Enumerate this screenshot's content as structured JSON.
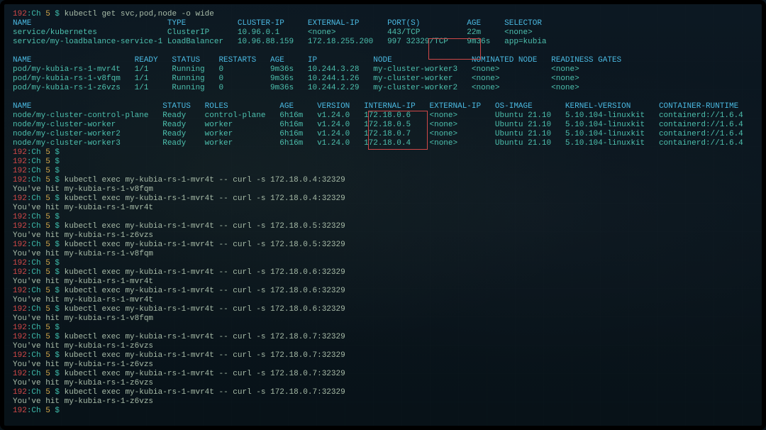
{
  "prompt_prefix_red": "192",
  "prompt_prefix_mid": ":Ch ",
  "prompt_prefix_yellow": "5",
  "prompt_suffix": " $ ",
  "cmd_get": "kubectl get svc,pod,node -o wide",
  "svc_header": "NAME                             TYPE           CLUSTER-IP     EXTERNAL-IP      PORT(S)          AGE     SELECTOR",
  "svc_rows": [
    "service/kubernetes               ClusterIP      10.96.0.1      <none>           443/TCP          22m     <none>",
    "service/my-loadbalance-service-1 LoadBalancer   10.96.88.159   172.18.255.200   997 32329/TCP    9m36s   app=kubia"
  ],
  "pod_header": "NAME                      READY   STATUS    RESTARTS   AGE     IP            NODE                 NOMINATED NODE   READINESS GATES",
  "pod_rows": [
    "pod/my-kubia-rs-1-mvr4t   1/1     Running   0          9m36s   10.244.3.28   my-cluster-worker3   <none>           <none>",
    "pod/my-kubia-rs-1-v8fqm   1/1     Running   0          9m36s   10.244.1.26   my-cluster-worker    <none>           <none>",
    "pod/my-kubia-rs-1-z6vzs   1/1     Running   0          9m36s   10.244.2.29   my-cluster-worker2   <none>           <none>"
  ],
  "node_header": "NAME                            STATUS   ROLES           AGE     VERSION   INTERNAL-IP   EXTERNAL-IP   OS-IMAGE       KERNEL-VERSION      CONTAINER-RUNTIME",
  "node_rows": [
    "node/my-cluster-control-plane   Ready    control-plane   6h16m   v1.24.0   172.18.0.6    <none>        Ubuntu 21.10   5.10.104-linuxkit   containerd://1.6.4",
    "node/my-cluster-worker          Ready    worker          6h16m   v1.24.0   172.18.0.5    <none>        Ubuntu 21.10   5.10.104-linuxkit   containerd://1.6.4",
    "node/my-cluster-worker2         Ready    worker          6h16m   v1.24.0   172.18.0.7    <none>        Ubuntu 21.10   5.10.104-linuxkit   containerd://1.6.4",
    "node/my-cluster-worker3         Ready    worker          6h16m   v1.24.0   172.18.0.4    <none>        Ubuntu 21.10   5.10.104-linuxkit   containerd://1.6.4"
  ],
  "empties": [
    "",
    ""
  ],
  "curl_blocks": [
    {
      "cmd": "kubectl exec my-kubia-rs-1-mvr4t -- curl -s 172.18.0.4:32329",
      "out": "You've hit my-kubia-rs-1-v8fqm"
    },
    {
      "cmd": "kubectl exec my-kubia-rs-1-mvr4t -- curl -s 172.18.0.4:32329",
      "out": "You've hit my-kubia-rs-1-mvr4t"
    },
    {
      "cmd": "kubectl exec my-kubia-rs-1-mvr4t -- curl -s 172.18.0.5:32329",
      "out": "You've hit my-kubia-rs-1-z6vzs"
    },
    {
      "cmd": "kubectl exec my-kubia-rs-1-mvr4t -- curl -s 172.18.0.5:32329",
      "out": "You've hit my-kubia-rs-1-v8fqm"
    },
    {
      "cmd": "kubectl exec my-kubia-rs-1-mvr4t -- curl -s 172.18.0.6:32329",
      "out": "You've hit my-kubia-rs-1-mvr4t"
    },
    {
      "cmd": "kubectl exec my-kubia-rs-1-mvr4t -- curl -s 172.18.0.6:32329",
      "out": "You've hit my-kubia-rs-1-mvr4t"
    },
    {
      "cmd": "kubectl exec my-kubia-rs-1-mvr4t -- curl -s 172.18.0.6:32329",
      "out": "You've hit my-kubia-rs-1-v8fqm"
    },
    {
      "cmd": "kubectl exec my-kubia-rs-1-mvr4t -- curl -s 172.18.0.7:32329",
      "out": "You've hit my-kubia-rs-1-z6vzs"
    },
    {
      "cmd": "kubectl exec my-kubia-rs-1-mvr4t -- curl -s 172.18.0.7:32329",
      "out": "You've hit my-kubia-rs-1-z6vzs"
    },
    {
      "cmd": "kubectl exec my-kubia-rs-1-mvr4t -- curl -s 172.18.0.7:32329",
      "out": "You've hit my-kubia-rs-1-z6vzs"
    },
    {
      "cmd": "kubectl exec my-kubia-rs-1-mvr4t -- curl -s 172.18.0.7:32329",
      "out": "You've hit my-kubia-rs-1-z6vzs"
    }
  ],
  "final_prompt": true,
  "colors": {
    "bg": "#0a1520",
    "header": "#4ab8e0",
    "data": "#4dc0ae",
    "red": "#d04848",
    "yellow": "#d4a84a"
  }
}
